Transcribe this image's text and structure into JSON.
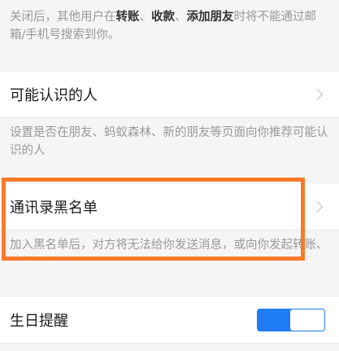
{
  "top_notice": {
    "prefix": "关闭后，其他用户在",
    "highlight1": "转账",
    "sep1": "、",
    "highlight2": "收款",
    "sep2": "、",
    "highlight3": "添加朋友",
    "suffix": "时将不能通过邮箱/手机号搜索到你。"
  },
  "known_people": {
    "label": "可能认识的人",
    "description": "设置是否在朋友、蚂蚁森林、新的朋友等页面向你推荐可能认识的人"
  },
  "blacklist": {
    "label": "通讯录黑名单",
    "description": "加入黑名单后，对方将无法给你发送消息，或向你发起转账、收款、代付"
  },
  "birthday_reminder": {
    "label": "生日提醒",
    "enabled": true
  },
  "colors": {
    "toggle_on": "#1f7cf2",
    "highlight_border": "#f97a2b"
  }
}
